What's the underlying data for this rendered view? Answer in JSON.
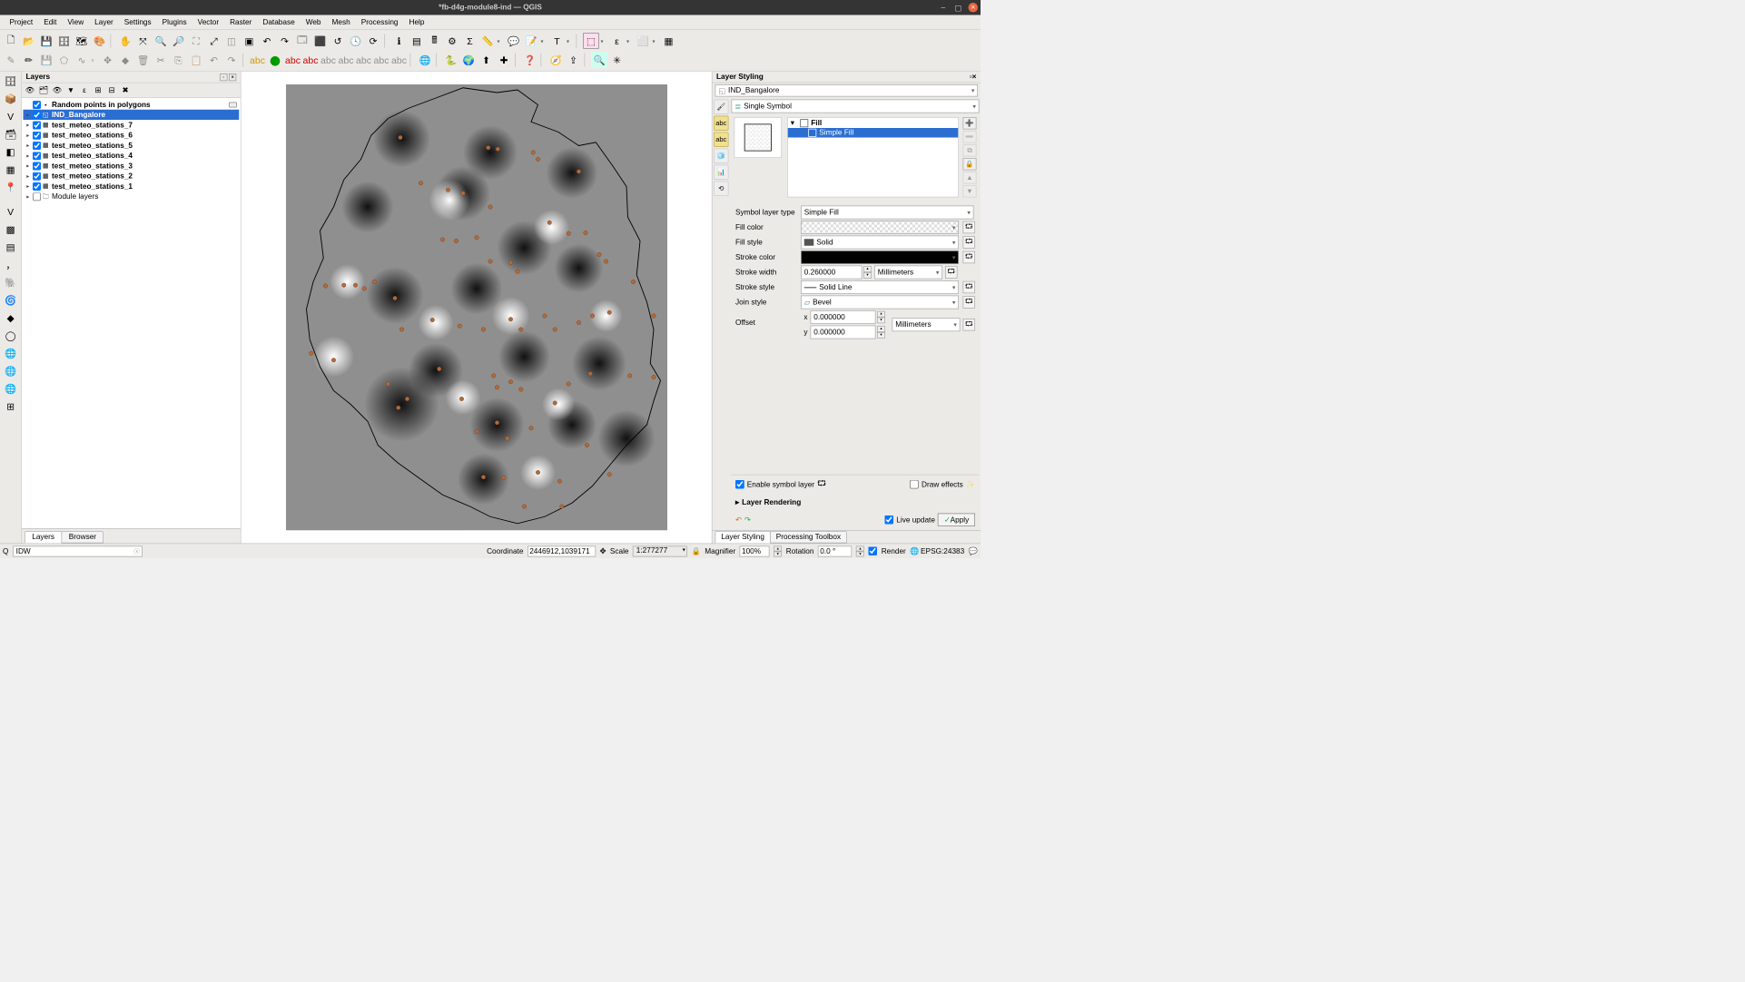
{
  "window": {
    "title": "*fb-d4g-module8-ind — QGIS"
  },
  "menu": [
    "Project",
    "Edit",
    "View",
    "Layer",
    "Settings",
    "Plugins",
    "Vector",
    "Raster",
    "Database",
    "Web",
    "Mesh",
    "Processing",
    "Help"
  ],
  "panels": {
    "layers_title": "Layers",
    "layers_tabs": {
      "layers": "Layers",
      "browser": "Browser"
    }
  },
  "layers": {
    "items": [
      {
        "name": "Random points in polygons",
        "checked": true,
        "selected": false,
        "icon": "point",
        "expandable": false,
        "extra": true
      },
      {
        "name": "IND_Bangalore",
        "checked": true,
        "selected": true,
        "icon": "poly",
        "expandable": true
      },
      {
        "name": "test_meteo_stations_7",
        "checked": true,
        "icon": "grid",
        "expandable": true
      },
      {
        "name": "test_meteo_stations_6",
        "checked": true,
        "icon": "grid",
        "expandable": true
      },
      {
        "name": "test_meteo_stations_5",
        "checked": true,
        "icon": "grid",
        "expandable": true
      },
      {
        "name": "test_meteo_stations_4",
        "checked": true,
        "icon": "grid",
        "expandable": true
      },
      {
        "name": "test_meteo_stations_3",
        "checked": true,
        "icon": "grid",
        "expandable": true
      },
      {
        "name": "test_meteo_stations_2",
        "checked": true,
        "icon": "grid",
        "expandable": true
      },
      {
        "name": "test_meteo_stations_1",
        "checked": true,
        "icon": "grid",
        "expandable": true
      },
      {
        "name": "Module layers",
        "checked": false,
        "icon": "group",
        "expandable": true,
        "plain": true
      }
    ]
  },
  "styling": {
    "title": "Layer Styling",
    "layer": "IND_Bangalore",
    "symbol_mode": "Single Symbol",
    "tree": {
      "root": "Fill",
      "child": "Simple Fill"
    },
    "symbol_layer_type_label": "Symbol layer type",
    "symbol_layer_type": "Simple Fill",
    "fill_color_label": "Fill color",
    "fill_style_label": "Fill style",
    "fill_style": "Solid",
    "stroke_color_label": "Stroke color",
    "stroke_color": "#000000",
    "stroke_width_label": "Stroke width",
    "stroke_width": "0.260000",
    "stroke_width_unit": "Millimeters",
    "stroke_style_label": "Stroke style",
    "stroke_style": "Solid Line",
    "join_style_label": "Join style",
    "join_style": "Bevel",
    "offset_label": "Offset",
    "offset_x_label": "x",
    "offset_x": "0.000000",
    "offset_y_label": "y",
    "offset_y": "0.000000",
    "offset_unit": "Millimeters",
    "enable_symbol_layer": "Enable symbol layer",
    "draw_effects": "Draw effects",
    "layer_rendering": "Layer Rendering",
    "live_update": "Live update",
    "apply": "Apply",
    "tabs": {
      "styling": "Layer Styling",
      "toolbox": "Processing Toolbox"
    }
  },
  "status": {
    "search_value": "IDW",
    "coordinate_label": "Coordinate",
    "coordinate": "2446912,1039171",
    "scale_label": "Scale",
    "scale": "1:277277",
    "magnifier_label": "Magnifier",
    "magnifier": "100%",
    "rotation_label": "Rotation",
    "rotation": "0.0 °",
    "render_label": "Render",
    "crs": "EPSG:24383"
  }
}
